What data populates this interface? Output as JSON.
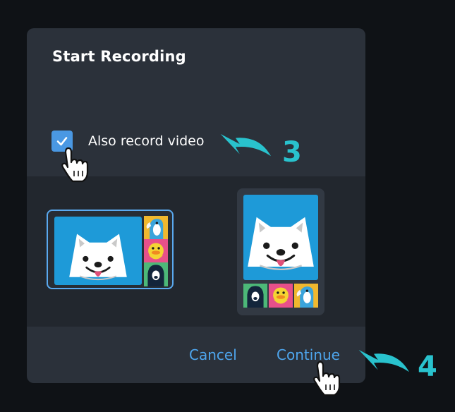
{
  "dialog": {
    "title": "Start Recording",
    "video_option": {
      "label": "Also record video",
      "checked": true
    },
    "layouts": [
      {
        "name": "speaker-side-layout",
        "selected": true
      },
      {
        "name": "speaker-top-layout",
        "selected": false
      }
    ],
    "footer": {
      "cancel_label": "Cancel",
      "continue_label": "Continue"
    }
  },
  "annotations": {
    "step_3": "3",
    "step_4": "4"
  },
  "colors": {
    "background": "#0f1216",
    "dialog": "#2b313a",
    "panel": "#22272e",
    "accent": "#4ea6ee",
    "annotation": "#29c2cd",
    "selected_border": "#5aa9ef"
  },
  "icons": [
    "check-icon",
    "hand-cursor-icon",
    "curved-arrow-icon",
    "samoyed-avatar",
    "toucan-avatar",
    "duck-avatar",
    "hooded-avatar"
  ]
}
